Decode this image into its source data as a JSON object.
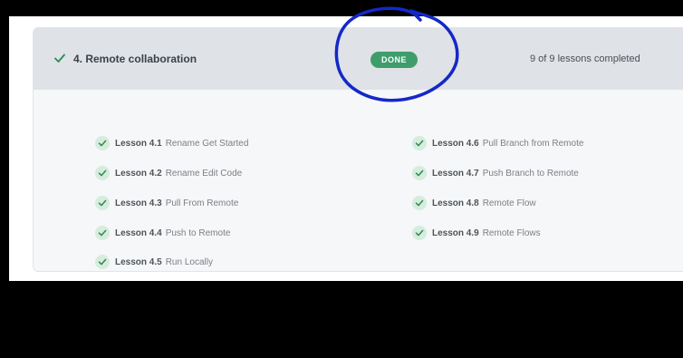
{
  "module": {
    "title": "4. Remote collaboration",
    "status_badge": "DONE",
    "progress_text": "9 of 9 lessons completed"
  },
  "lessons_left": [
    {
      "number": "Lesson 4.1",
      "name": "Rename Get Started"
    },
    {
      "number": "Lesson 4.2",
      "name": "Rename Edit Code"
    },
    {
      "number": "Lesson 4.3",
      "name": "Pull From Remote"
    },
    {
      "number": "Lesson 4.4",
      "name": "Push to Remote"
    },
    {
      "number": "Lesson 4.5",
      "name": "Run Locally"
    }
  ],
  "lessons_right": [
    {
      "number": "Lesson 4.6",
      "name": "Pull Branch from Remote"
    },
    {
      "number": "Lesson 4.7",
      "name": "Push Branch to Remote"
    },
    {
      "number": "Lesson 4.8",
      "name": "Remote Flow"
    },
    {
      "number": "Lesson 4.9",
      "name": "Remote Flows"
    }
  ],
  "icons": {
    "header_check": "check-icon",
    "lesson_check": "check-circle-icon"
  },
  "colors": {
    "badge": "#3f9d6b",
    "annotation": "#1428c8",
    "check": "#2f8a55"
  }
}
